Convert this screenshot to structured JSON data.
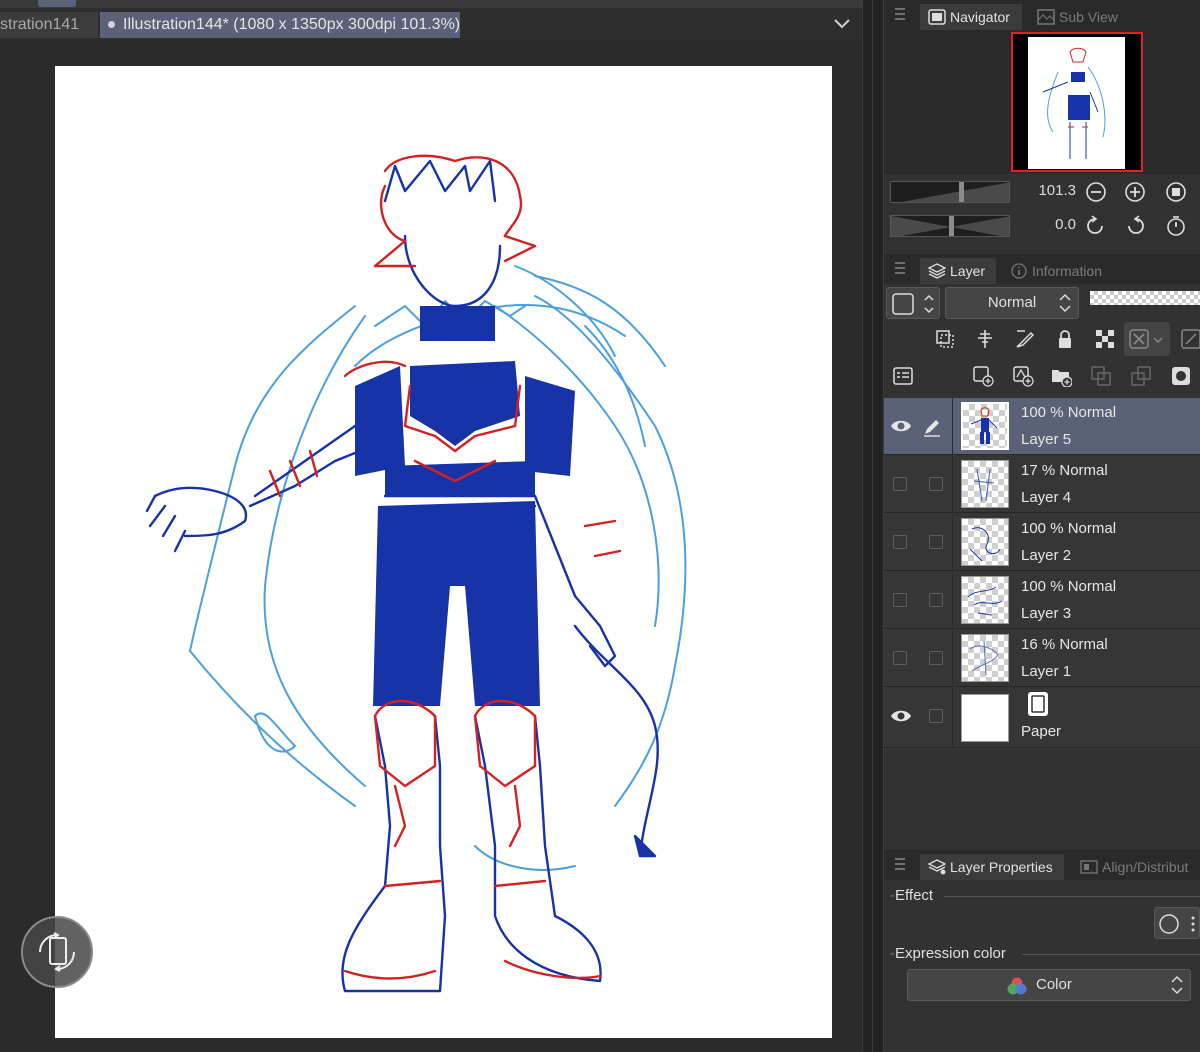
{
  "tabs": [
    {
      "label": "stration141"
    },
    {
      "label": "Illustration144* (1080 x 1350px 300dpi 101.3%)"
    }
  ],
  "navigator": {
    "tab_label": "Navigator",
    "subview_label": "Sub View",
    "zoom_value": "101.3",
    "rotation_value": "0.0"
  },
  "layer_panel": {
    "tab_label": "Layer",
    "info_label": "Information",
    "blend_mode": "Normal",
    "layers": [
      {
        "mode": "100 % Normal",
        "name": "Layer 5",
        "visible": true,
        "selected": true
      },
      {
        "mode": "17 % Normal",
        "name": "Layer 4",
        "visible": false,
        "selected": false
      },
      {
        "mode": "100 % Normal",
        "name": "Layer 2",
        "visible": false,
        "selected": false
      },
      {
        "mode": "100 % Normal",
        "name": "Layer 3",
        "visible": false,
        "selected": false
      },
      {
        "mode": "16 % Normal",
        "name": "Layer 1",
        "visible": false,
        "selected": false
      }
    ],
    "paper_layer": {
      "name": "Paper",
      "visible": true
    }
  },
  "layer_properties": {
    "tab_label": "Layer Properties",
    "align_label": "Align/Distribut",
    "effect_label": "Effect",
    "expression_label": "Expression color",
    "expression_value": "Color"
  },
  "colors": {
    "accent_selected": "#5b6277",
    "line_blue": "#1733a8",
    "line_red": "#d42222",
    "line_light_blue": "#4aa0e0"
  }
}
